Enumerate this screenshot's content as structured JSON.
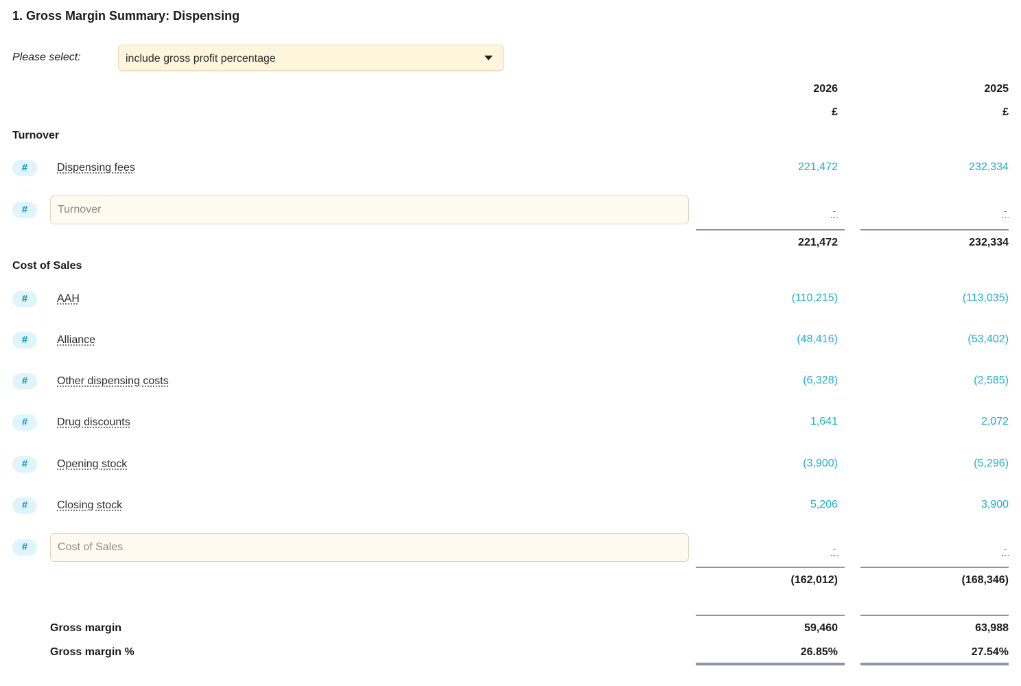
{
  "page": {
    "title": "1. Gross Margin Summary: Dispensing",
    "select_label": "Please select:",
    "select_value": "include gross profit percentage"
  },
  "columns": [
    {
      "year": "2026",
      "unit": "£"
    },
    {
      "year": "2025",
      "unit": "£"
    }
  ],
  "badge_icon": "#",
  "turnover": {
    "heading": "Turnover",
    "rows": [
      {
        "label": "Dispensing fees",
        "v2026": "221,472",
        "v2025": "232,334"
      }
    ],
    "note_placeholder": "Turnover",
    "blank_2026": "-",
    "blank_2025": "-",
    "total_2026": "221,472",
    "total_2025": "232,334"
  },
  "cost_of_sales": {
    "heading": "Cost of Sales",
    "rows": [
      {
        "label": "AAH",
        "v2026": "(110,215)",
        "v2025": "(113,035)"
      },
      {
        "label": "Alliance",
        "v2026": "(48,416)",
        "v2025": "(53,402)"
      },
      {
        "label": "Other dispensing costs",
        "v2026": "(6,328)",
        "v2025": "(2,585)"
      },
      {
        "label": "Drug discounts",
        "v2026": "1,641",
        "v2025": "2,072"
      },
      {
        "label": "Opening stock",
        "v2026": "(3,900)",
        "v2025": "(5,296)"
      },
      {
        "label": "Closing stock",
        "v2026": "5,206",
        "v2025": "3,900"
      }
    ],
    "note_placeholder": "Cost of Sales",
    "blank_2026": "-",
    "blank_2025": "-",
    "total_2026": "(162,012)",
    "total_2025": "(168,346)"
  },
  "summary": {
    "gross_margin_label": "Gross margin",
    "gross_margin_2026": "59,460",
    "gross_margin_2025": "63,988",
    "gross_margin_pct_label": "Gross margin %",
    "gross_margin_pct_2026": "26.85%",
    "gross_margin_pct_2025": "27.54%"
  },
  "colors": {
    "accent_value": "#1eaecd",
    "badge_bg": "#dff5fb",
    "select_bg": "#fdf6dd",
    "input_bg": "#fefaf0"
  }
}
